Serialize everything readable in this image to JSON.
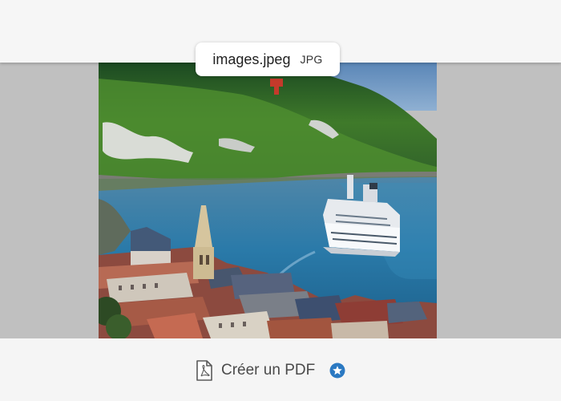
{
  "file": {
    "name": "images.jpeg",
    "type": "JPG"
  },
  "actions": {
    "create_pdf_label": "Créer un PDF"
  },
  "icons": {
    "pdf": "pdf-file-icon",
    "badge": "star-badge-icon"
  },
  "colors": {
    "badge": "#2b79c2",
    "viewer_background": "#c0c0c0"
  }
}
